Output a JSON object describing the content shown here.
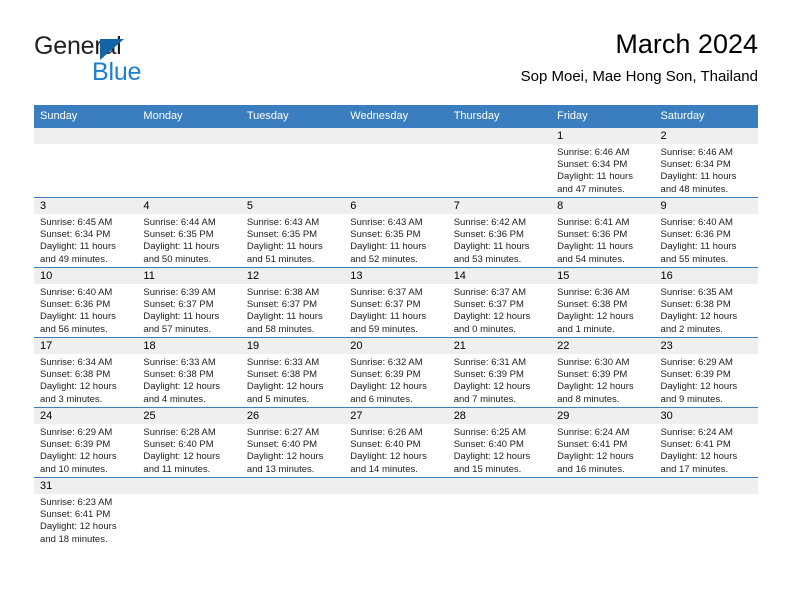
{
  "logo": {
    "text_top": "General",
    "text_bottom": "Blue",
    "triangle_color": "#1463a5",
    "blue_color": "#1b7fd4"
  },
  "header": {
    "title": "March 2024",
    "subtitle": "Sop Moei, Mae Hong Son, Thailand"
  },
  "theme": {
    "header_blue": "#3a7ebf",
    "daynum_band": "#efefef"
  },
  "weekdays": [
    "Sunday",
    "Monday",
    "Tuesday",
    "Wednesday",
    "Thursday",
    "Friday",
    "Saturday"
  ],
  "weeks": [
    [
      {
        "day": "",
        "sunrise": "",
        "sunset": "",
        "daylight_1": "",
        "daylight_2": "",
        "empty": true
      },
      {
        "day": "",
        "sunrise": "",
        "sunset": "",
        "daylight_1": "",
        "daylight_2": "",
        "empty": true
      },
      {
        "day": "",
        "sunrise": "",
        "sunset": "",
        "daylight_1": "",
        "daylight_2": "",
        "empty": true
      },
      {
        "day": "",
        "sunrise": "",
        "sunset": "",
        "daylight_1": "",
        "daylight_2": "",
        "empty": true
      },
      {
        "day": "",
        "sunrise": "",
        "sunset": "",
        "daylight_1": "",
        "daylight_2": "",
        "empty": true
      },
      {
        "day": "1",
        "sunrise": "Sunrise: 6:46 AM",
        "sunset": "Sunset: 6:34 PM",
        "daylight_1": "Daylight: 11 hours",
        "daylight_2": "and 47 minutes."
      },
      {
        "day": "2",
        "sunrise": "Sunrise: 6:46 AM",
        "sunset": "Sunset: 6:34 PM",
        "daylight_1": "Daylight: 11 hours",
        "daylight_2": "and 48 minutes."
      }
    ],
    [
      {
        "day": "3",
        "sunrise": "Sunrise: 6:45 AM",
        "sunset": "Sunset: 6:34 PM",
        "daylight_1": "Daylight: 11 hours",
        "daylight_2": "and 49 minutes."
      },
      {
        "day": "4",
        "sunrise": "Sunrise: 6:44 AM",
        "sunset": "Sunset: 6:35 PM",
        "daylight_1": "Daylight: 11 hours",
        "daylight_2": "and 50 minutes."
      },
      {
        "day": "5",
        "sunrise": "Sunrise: 6:43 AM",
        "sunset": "Sunset: 6:35 PM",
        "daylight_1": "Daylight: 11 hours",
        "daylight_2": "and 51 minutes."
      },
      {
        "day": "6",
        "sunrise": "Sunrise: 6:43 AM",
        "sunset": "Sunset: 6:35 PM",
        "daylight_1": "Daylight: 11 hours",
        "daylight_2": "and 52 minutes."
      },
      {
        "day": "7",
        "sunrise": "Sunrise: 6:42 AM",
        "sunset": "Sunset: 6:36 PM",
        "daylight_1": "Daylight: 11 hours",
        "daylight_2": "and 53 minutes."
      },
      {
        "day": "8",
        "sunrise": "Sunrise: 6:41 AM",
        "sunset": "Sunset: 6:36 PM",
        "daylight_1": "Daylight: 11 hours",
        "daylight_2": "and 54 minutes."
      },
      {
        "day": "9",
        "sunrise": "Sunrise: 6:40 AM",
        "sunset": "Sunset: 6:36 PM",
        "daylight_1": "Daylight: 11 hours",
        "daylight_2": "and 55 minutes."
      }
    ],
    [
      {
        "day": "10",
        "sunrise": "Sunrise: 6:40 AM",
        "sunset": "Sunset: 6:36 PM",
        "daylight_1": "Daylight: 11 hours",
        "daylight_2": "and 56 minutes."
      },
      {
        "day": "11",
        "sunrise": "Sunrise: 6:39 AM",
        "sunset": "Sunset: 6:37 PM",
        "daylight_1": "Daylight: 11 hours",
        "daylight_2": "and 57 minutes."
      },
      {
        "day": "12",
        "sunrise": "Sunrise: 6:38 AM",
        "sunset": "Sunset: 6:37 PM",
        "daylight_1": "Daylight: 11 hours",
        "daylight_2": "and 58 minutes."
      },
      {
        "day": "13",
        "sunrise": "Sunrise: 6:37 AM",
        "sunset": "Sunset: 6:37 PM",
        "daylight_1": "Daylight: 11 hours",
        "daylight_2": "and 59 minutes."
      },
      {
        "day": "14",
        "sunrise": "Sunrise: 6:37 AM",
        "sunset": "Sunset: 6:37 PM",
        "daylight_1": "Daylight: 12 hours",
        "daylight_2": "and 0 minutes."
      },
      {
        "day": "15",
        "sunrise": "Sunrise: 6:36 AM",
        "sunset": "Sunset: 6:38 PM",
        "daylight_1": "Daylight: 12 hours",
        "daylight_2": "and 1 minute."
      },
      {
        "day": "16",
        "sunrise": "Sunrise: 6:35 AM",
        "sunset": "Sunset: 6:38 PM",
        "daylight_1": "Daylight: 12 hours",
        "daylight_2": "and 2 minutes."
      }
    ],
    [
      {
        "day": "17",
        "sunrise": "Sunrise: 6:34 AM",
        "sunset": "Sunset: 6:38 PM",
        "daylight_1": "Daylight: 12 hours",
        "daylight_2": "and 3 minutes."
      },
      {
        "day": "18",
        "sunrise": "Sunrise: 6:33 AM",
        "sunset": "Sunset: 6:38 PM",
        "daylight_1": "Daylight: 12 hours",
        "daylight_2": "and 4 minutes."
      },
      {
        "day": "19",
        "sunrise": "Sunrise: 6:33 AM",
        "sunset": "Sunset: 6:38 PM",
        "daylight_1": "Daylight: 12 hours",
        "daylight_2": "and 5 minutes."
      },
      {
        "day": "20",
        "sunrise": "Sunrise: 6:32 AM",
        "sunset": "Sunset: 6:39 PM",
        "daylight_1": "Daylight: 12 hours",
        "daylight_2": "and 6 minutes."
      },
      {
        "day": "21",
        "sunrise": "Sunrise: 6:31 AM",
        "sunset": "Sunset: 6:39 PM",
        "daylight_1": "Daylight: 12 hours",
        "daylight_2": "and 7 minutes."
      },
      {
        "day": "22",
        "sunrise": "Sunrise: 6:30 AM",
        "sunset": "Sunset: 6:39 PM",
        "daylight_1": "Daylight: 12 hours",
        "daylight_2": "and 8 minutes."
      },
      {
        "day": "23",
        "sunrise": "Sunrise: 6:29 AM",
        "sunset": "Sunset: 6:39 PM",
        "daylight_1": "Daylight: 12 hours",
        "daylight_2": "and 9 minutes."
      }
    ],
    [
      {
        "day": "24",
        "sunrise": "Sunrise: 6:29 AM",
        "sunset": "Sunset: 6:39 PM",
        "daylight_1": "Daylight: 12 hours",
        "daylight_2": "and 10 minutes."
      },
      {
        "day": "25",
        "sunrise": "Sunrise: 6:28 AM",
        "sunset": "Sunset: 6:40 PM",
        "daylight_1": "Daylight: 12 hours",
        "daylight_2": "and 11 minutes."
      },
      {
        "day": "26",
        "sunrise": "Sunrise: 6:27 AM",
        "sunset": "Sunset: 6:40 PM",
        "daylight_1": "Daylight: 12 hours",
        "daylight_2": "and 13 minutes."
      },
      {
        "day": "27",
        "sunrise": "Sunrise: 6:26 AM",
        "sunset": "Sunset: 6:40 PM",
        "daylight_1": "Daylight: 12 hours",
        "daylight_2": "and 14 minutes."
      },
      {
        "day": "28",
        "sunrise": "Sunrise: 6:25 AM",
        "sunset": "Sunset: 6:40 PM",
        "daylight_1": "Daylight: 12 hours",
        "daylight_2": "and 15 minutes."
      },
      {
        "day": "29",
        "sunrise": "Sunrise: 6:24 AM",
        "sunset": "Sunset: 6:41 PM",
        "daylight_1": "Daylight: 12 hours",
        "daylight_2": "and 16 minutes."
      },
      {
        "day": "30",
        "sunrise": "Sunrise: 6:24 AM",
        "sunset": "Sunset: 6:41 PM",
        "daylight_1": "Daylight: 12 hours",
        "daylight_2": "and 17 minutes."
      }
    ],
    [
      {
        "day": "31",
        "sunrise": "Sunrise: 6:23 AM",
        "sunset": "Sunset: 6:41 PM",
        "daylight_1": "Daylight: 12 hours",
        "daylight_2": "and 18 minutes."
      },
      {
        "day": "",
        "sunrise": "",
        "sunset": "",
        "daylight_1": "",
        "daylight_2": "",
        "empty": true
      },
      {
        "day": "",
        "sunrise": "",
        "sunset": "",
        "daylight_1": "",
        "daylight_2": "",
        "empty": true
      },
      {
        "day": "",
        "sunrise": "",
        "sunset": "",
        "daylight_1": "",
        "daylight_2": "",
        "empty": true
      },
      {
        "day": "",
        "sunrise": "",
        "sunset": "",
        "daylight_1": "",
        "daylight_2": "",
        "empty": true
      },
      {
        "day": "",
        "sunrise": "",
        "sunset": "",
        "daylight_1": "",
        "daylight_2": "",
        "empty": true
      },
      {
        "day": "",
        "sunrise": "",
        "sunset": "",
        "daylight_1": "",
        "daylight_2": "",
        "empty": true
      }
    ]
  ]
}
